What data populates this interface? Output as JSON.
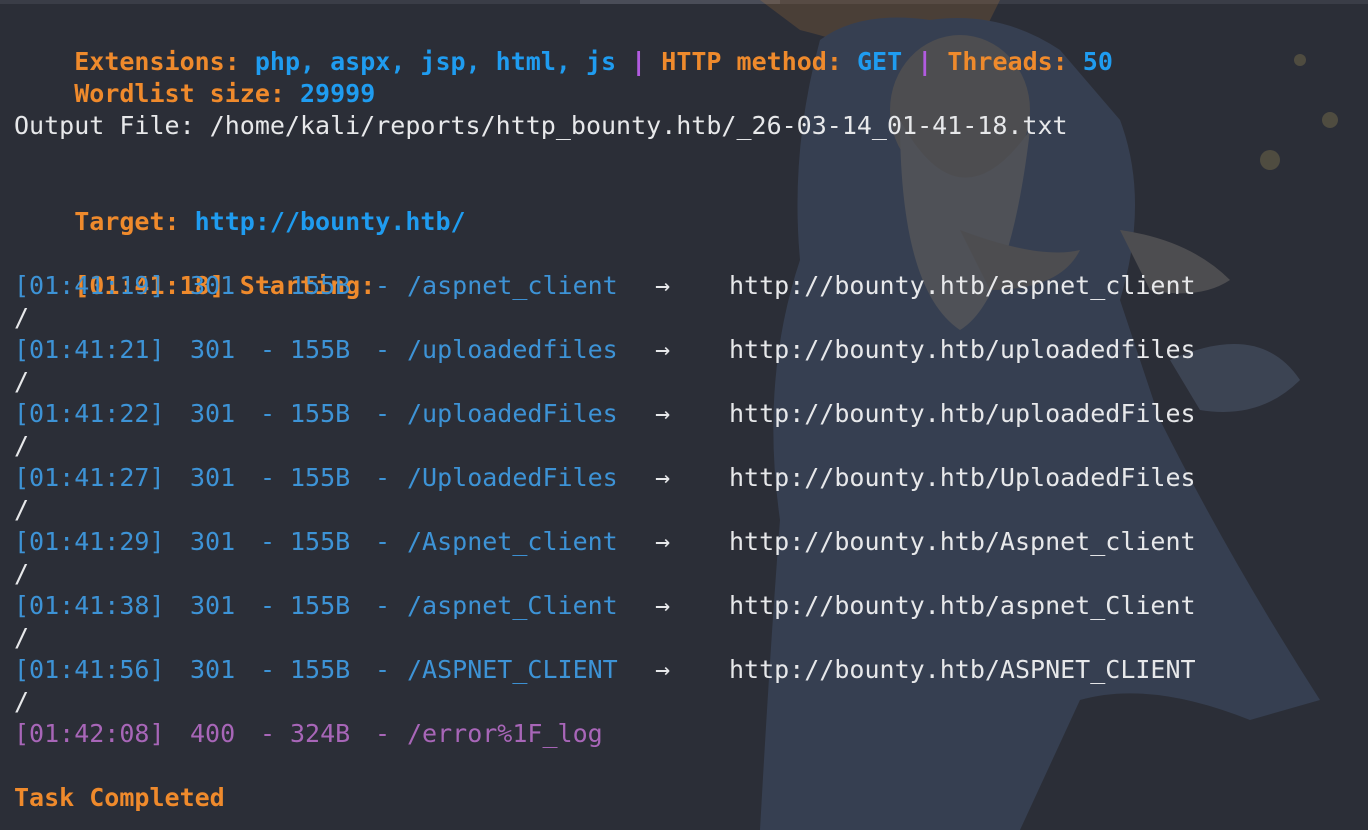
{
  "header": {
    "extensions_label": "Extensions:",
    "extensions_value": "php, aspx, jsp, html, js",
    "separator": "|",
    "method_label": "HTTP method:",
    "method_value": "GET",
    "threads_label": "Threads:",
    "threads_value": "50",
    "wordlist_label": "Wordlist size:",
    "wordlist_value": "29999"
  },
  "output_file": "Output File: /home/kali/reports/http_bounty.htb/_26-03-14_01-41-18.txt",
  "target": {
    "label": "Target:",
    "url": "http://bounty.htb/"
  },
  "start": {
    "timestamp": "[01:41:18]",
    "label": "Starting:"
  },
  "results": [
    {
      "timestamp": "[01:41:19]",
      "status": "301",
      "dash": "-",
      "size": "155B",
      "dash2": "-",
      "path": "/aspnet_client",
      "arrow": "→",
      "redirect": "http://bounty.htb/aspnet_client",
      "wrap": "/"
    },
    {
      "timestamp": "[01:41:21]",
      "status": "301",
      "dash": "-",
      "size": "155B",
      "dash2": "-",
      "path": "/uploadedfiles",
      "arrow": "→",
      "redirect": "http://bounty.htb/uploadedfiles",
      "wrap": "/"
    },
    {
      "timestamp": "[01:41:22]",
      "status": "301",
      "dash": "-",
      "size": "155B",
      "dash2": "-",
      "path": "/uploadedFiles",
      "arrow": "→",
      "redirect": "http://bounty.htb/uploadedFiles",
      "wrap": "/"
    },
    {
      "timestamp": "[01:41:27]",
      "status": "301",
      "dash": "-",
      "size": "155B",
      "dash2": "-",
      "path": "/UploadedFiles",
      "arrow": "→",
      "redirect": "http://bounty.htb/UploadedFiles",
      "wrap": "/"
    },
    {
      "timestamp": "[01:41:29]",
      "status": "301",
      "dash": "-",
      "size": "155B",
      "dash2": "-",
      "path": "/Aspnet_client",
      "arrow": "→",
      "redirect": "http://bounty.htb/Aspnet_client",
      "wrap": "/"
    },
    {
      "timestamp": "[01:41:38]",
      "status": "301",
      "dash": "-",
      "size": "155B",
      "dash2": "-",
      "path": "/aspnet_Client",
      "arrow": "→",
      "redirect": "http://bounty.htb/aspnet_Client",
      "wrap": "/"
    },
    {
      "timestamp": "[01:41:56]",
      "status": "301",
      "dash": "-",
      "size": "155B",
      "dash2": "-",
      "path": "/ASPNET_CLIENT",
      "arrow": "→",
      "redirect": "http://bounty.htb/ASPNET_CLIENT",
      "wrap": "/"
    },
    {
      "timestamp": "[01:42:08]",
      "status": "400",
      "dash": "-",
      "size": "324B",
      "dash2": "-",
      "path": "/error%1F_log"
    }
  ],
  "footer": "Task Completed",
  "colors": {
    "background": "#2b2e37",
    "orange": "#ef8a2c",
    "blue": "#1f9cf0",
    "purple": "#b25be0",
    "redirect_blue": "#3d93d6",
    "error_mauve": "#a866b8",
    "text": "#e7e8ea"
  }
}
